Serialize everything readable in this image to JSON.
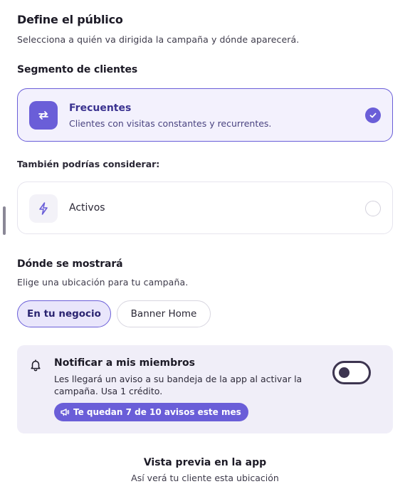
{
  "header": {
    "title": "Define el público",
    "subtitle": "Selecciona a quién va dirigida la campaña y dónde aparecerá."
  },
  "segment": {
    "title": "Segmento de clientes",
    "selected": {
      "icon": "repeat-arrows-icon",
      "label": "Frecuentes",
      "description": "Clientes con visitas constantes y recurrentes.",
      "checked": true
    },
    "suggest_title": "También podrías considerar:",
    "options": [
      {
        "icon": "lightning-icon",
        "label": "Activos",
        "checked": false
      }
    ]
  },
  "placement": {
    "title": "Dónde se mostrará",
    "subtitle": "Elige una ubicación para tu campaña.",
    "options": [
      {
        "label": "En tu negocio",
        "active": true
      },
      {
        "label": "Banner Home",
        "active": false
      }
    ]
  },
  "notify": {
    "icon": "bell-icon",
    "title": "Notificar a mis miembros",
    "description": "Les llegará un aviso a su bandeja de la app al activar la campaña. Usa 1 crédito.",
    "badge_icon": "megaphone-icon",
    "badge": "Te quedan 7 de 10 avisos este mes",
    "enabled": false
  },
  "preview": {
    "title": "Vista previa en la app",
    "subtitle": "Así verá tu cliente esta ubicación"
  },
  "colors": {
    "accent": "#6a5ed8",
    "selected_bg": "#f3f1fd",
    "notify_bg": "#f0eef8"
  }
}
